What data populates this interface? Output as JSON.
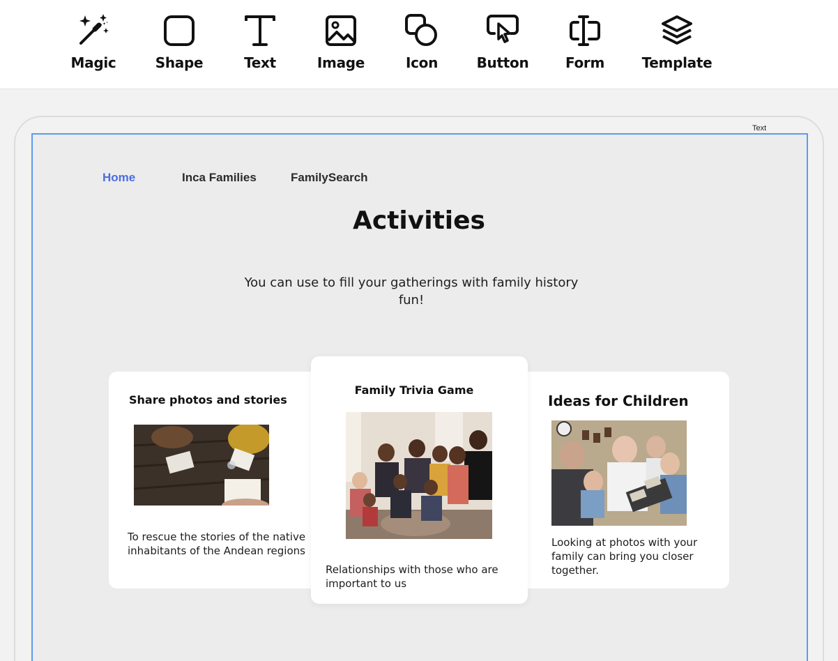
{
  "toolbar": {
    "tools": [
      {
        "label": "Magic",
        "icon": "magic-wand-icon"
      },
      {
        "label": "Shape",
        "icon": "rounded-square-icon"
      },
      {
        "label": "Text",
        "icon": "text-t-icon"
      },
      {
        "label": "Image",
        "icon": "image-icon"
      },
      {
        "label": "Icon",
        "icon": "shapes-icon"
      },
      {
        "label": "Button",
        "icon": "pointer-click-icon"
      },
      {
        "label": "Form",
        "icon": "text-cursor-input-icon"
      },
      {
        "label": "Template",
        "icon": "layers-icon"
      }
    ]
  },
  "canvas": {
    "selection_tag": "Text",
    "selection_color": "#5b9bf0"
  },
  "nav": {
    "home": "Home",
    "inca_families": "Inca Families",
    "family_search": "FamilySearch",
    "active_color": "#4a6de0"
  },
  "page": {
    "title": "Activities",
    "subtitle": "You can use to fill your gatherings with family history fun!"
  },
  "cards": [
    {
      "title": "Share photos and stories",
      "text": "To rescue the stories of the native inhabitants of the Andean regions"
    },
    {
      "title": "Family Trivia Game",
      "text": "Relationships with those who are important to us"
    },
    {
      "title": "Ideas for Children",
      "text": "Looking at photos with your family can bring you closer together."
    }
  ]
}
